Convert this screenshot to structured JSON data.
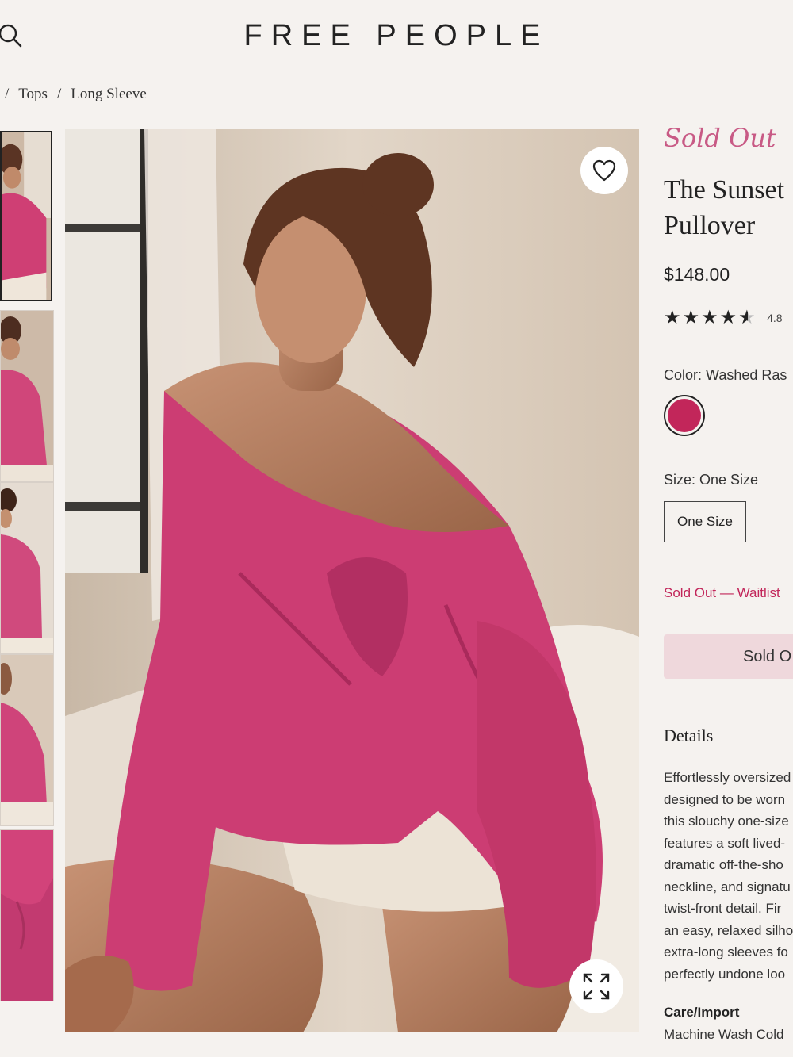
{
  "header": {
    "logo": "FREE PEOPLE",
    "search_icon": "search-icon"
  },
  "breadcrumb": {
    "separator": "/",
    "items": [
      "Tops",
      "Long Sleeve"
    ]
  },
  "gallery": {
    "thumbnail_count": 5,
    "favorite_icon": "heart-icon",
    "expand_icon": "expand-icon"
  },
  "product": {
    "status": "Sold Out",
    "title_line1": "The Sunset",
    "title_line2": "Pullover",
    "price": "$148.00",
    "rating": 4.8,
    "rating_text": "4.8",
    "stars_display": 4.5,
    "color_label": "Color: Washed Ras",
    "color_hex": "#c2265a",
    "size_label": "Size: One Size",
    "size_option": "One Size",
    "waitlist_text": "Sold Out — Waitlist",
    "button_label": "Sold O"
  },
  "details": {
    "heading": "Details",
    "lines": [
      "Effortlessly oversized",
      "designed to be worn",
      "this slouchy one-size",
      "features a soft lived-",
      "dramatic off-the-sho",
      "neckline, and signatu",
      "twist-front detail. Fir",
      "an easy, relaxed silho",
      "extra-long sleeves fo",
      "perfectly undone loo"
    ],
    "care_heading": "Care/Import",
    "care_text": "Machine Wash Cold"
  },
  "colors": {
    "accent_pink": "#c85a85",
    "swatch": "#c2265a",
    "button_bg": "#efd8dc",
    "background": "#f5f2ef"
  }
}
